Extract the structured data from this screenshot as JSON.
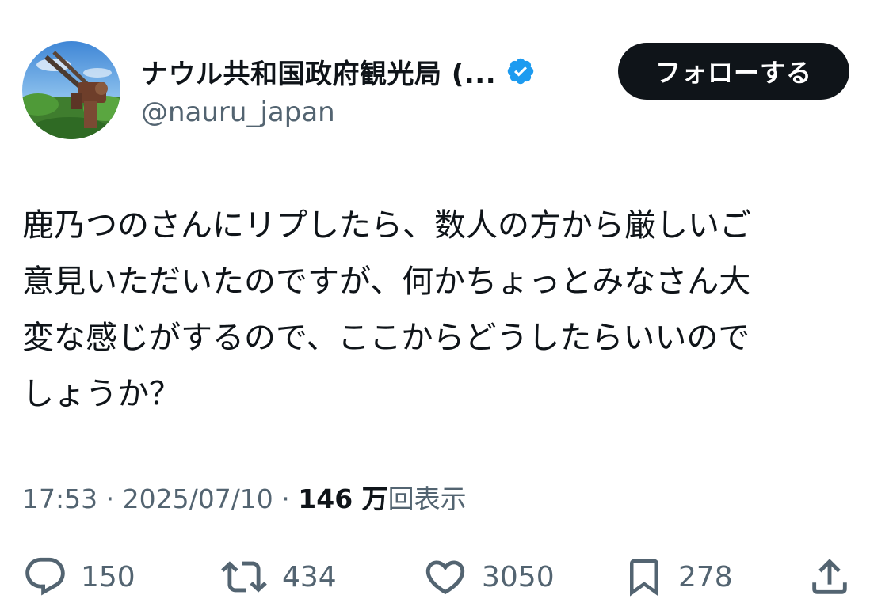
{
  "author": {
    "display_name": "ナウル共和国政府観光局 (...",
    "handle": "@nauru_japan",
    "verified": true
  },
  "follow_button": {
    "label": "フォローする"
  },
  "tweet": {
    "text": "鹿乃つのさんにリプしたら、数人の方から厳しいご\n意見いただいたのですが、何かちょっとみなさん大\n変な感じがするので、ここからどうしたらいいので\nしょうか？"
  },
  "meta": {
    "time": "17:53",
    "separator1": " · ",
    "date": "2025/07/10",
    "separator2": " · ",
    "views_count": "146 万",
    "views_label": "回表示"
  },
  "actions": {
    "reply": {
      "icon": "reply-icon",
      "count": "150"
    },
    "retweet": {
      "icon": "retweet-icon",
      "count": "434"
    },
    "like": {
      "icon": "heart-icon",
      "count": "3050"
    },
    "bookmark": {
      "icon": "bookmark-icon",
      "count": "278"
    },
    "share": {
      "icon": "share-icon"
    }
  },
  "colors": {
    "text_primary": "#0f1419",
    "text_secondary": "#536471",
    "verified_blue": "#1d9bf0",
    "button_bg": "#0f1419",
    "button_text": "#ffffff"
  }
}
